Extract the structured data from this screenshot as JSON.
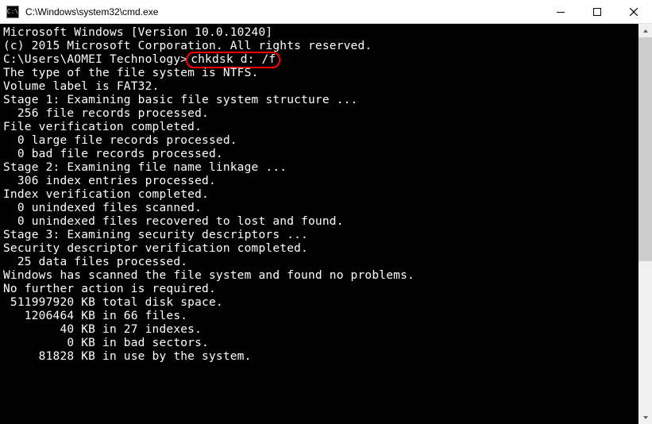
{
  "window": {
    "title": "C:\\Windows\\system32\\cmd.exe",
    "icon_label": "cmd-icon"
  },
  "prompt": "C:\\Users\\AOMEI Technology>",
  "command": "chkdsk d: /f",
  "output": {
    "l0": "Microsoft Windows [Version 10.0.10240]",
    "l1": "(c) 2015 Microsoft Corporation. All rights reserved.",
    "l2": "",
    "l3": "The type of the file system is NTFS.",
    "l4": "Volume label is FAT32.",
    "l5": "",
    "l6": "Stage 1: Examining basic file system structure ...",
    "l7": "  256 file records processed.",
    "l8": "File verification completed.",
    "l9": "  0 large file records processed.",
    "l10": "  0 bad file records processed.",
    "l11": "",
    "l12": "Stage 2: Examining file name linkage ...",
    "l13": "  306 index entries processed.",
    "l14": "Index verification completed.",
    "l15": "  0 unindexed files scanned.",
    "l16": "  0 unindexed files recovered to lost and found.",
    "l17": "",
    "l18": "Stage 3: Examining security descriptors ...",
    "l19": "Security descriptor verification completed.",
    "l20": "  25 data files processed.",
    "l21": "",
    "l22": "Windows has scanned the file system and found no problems.",
    "l23": "No further action is required.",
    "l24": "",
    "l25": " 511997920 KB total disk space.",
    "l26": "   1206464 KB in 66 files.",
    "l27": "        40 KB in 27 indexes.",
    "l28": "         0 KB in bad sectors.",
    "l29": "     81828 KB in use by the system."
  }
}
